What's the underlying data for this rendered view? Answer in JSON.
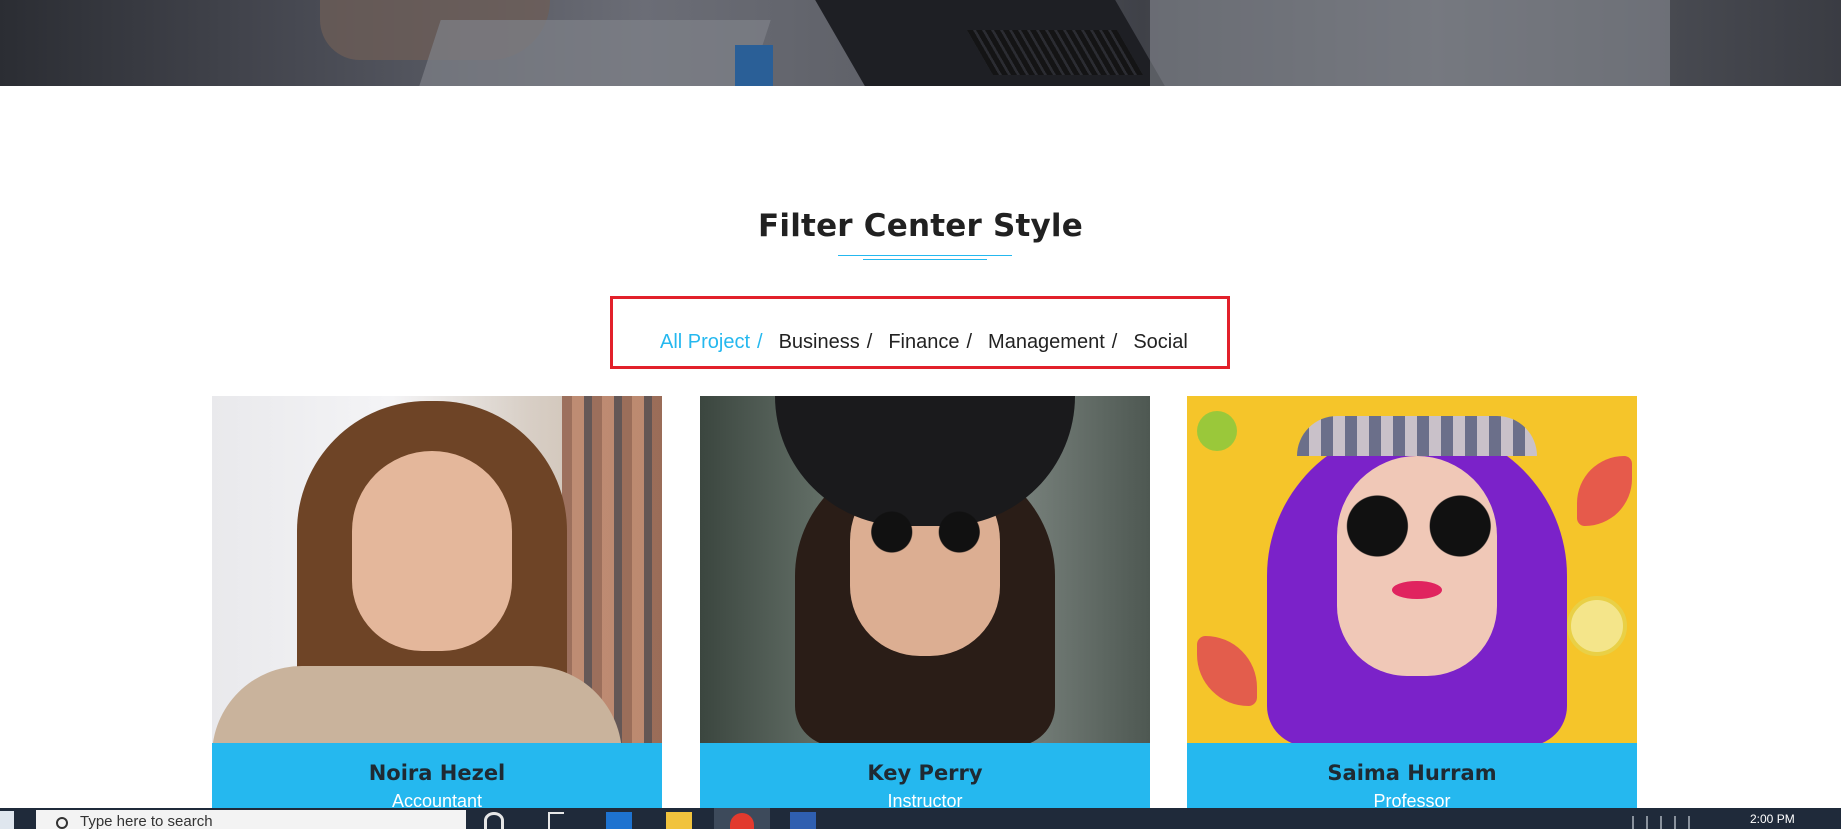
{
  "section": {
    "title": "Filter Center Style"
  },
  "filter": {
    "items": [
      {
        "label": "All Project",
        "sep": "/",
        "active": true
      },
      {
        "label": "Business",
        "sep": "/",
        "active": false
      },
      {
        "label": "Finance",
        "sep": "/",
        "active": false
      },
      {
        "label": "Management",
        "sep": "/",
        "active": false
      },
      {
        "label": "Social",
        "sep": "",
        "active": false
      }
    ],
    "active_color": "#25b8ef",
    "highlight_color": "#e2202a"
  },
  "cards": [
    {
      "name": "Noira Hezel",
      "role": "Accountant"
    },
    {
      "name": "Key Perry",
      "role": "Instructor"
    },
    {
      "name": "Saima Hurram",
      "role": "Professor"
    }
  ],
  "colors": {
    "accent": "#25b8ef",
    "heading": "#212121",
    "taskbar": "#1f2a3a"
  },
  "taskbar": {
    "search_placeholder": "Type here to search",
    "clock": "2:00 PM",
    "icons": [
      "windows-start-icon",
      "search-icon",
      "cortana-icon",
      "task-view-icon",
      "outlook-icon",
      "file-explorer-icon",
      "chrome-icon",
      "word-icon"
    ]
  }
}
